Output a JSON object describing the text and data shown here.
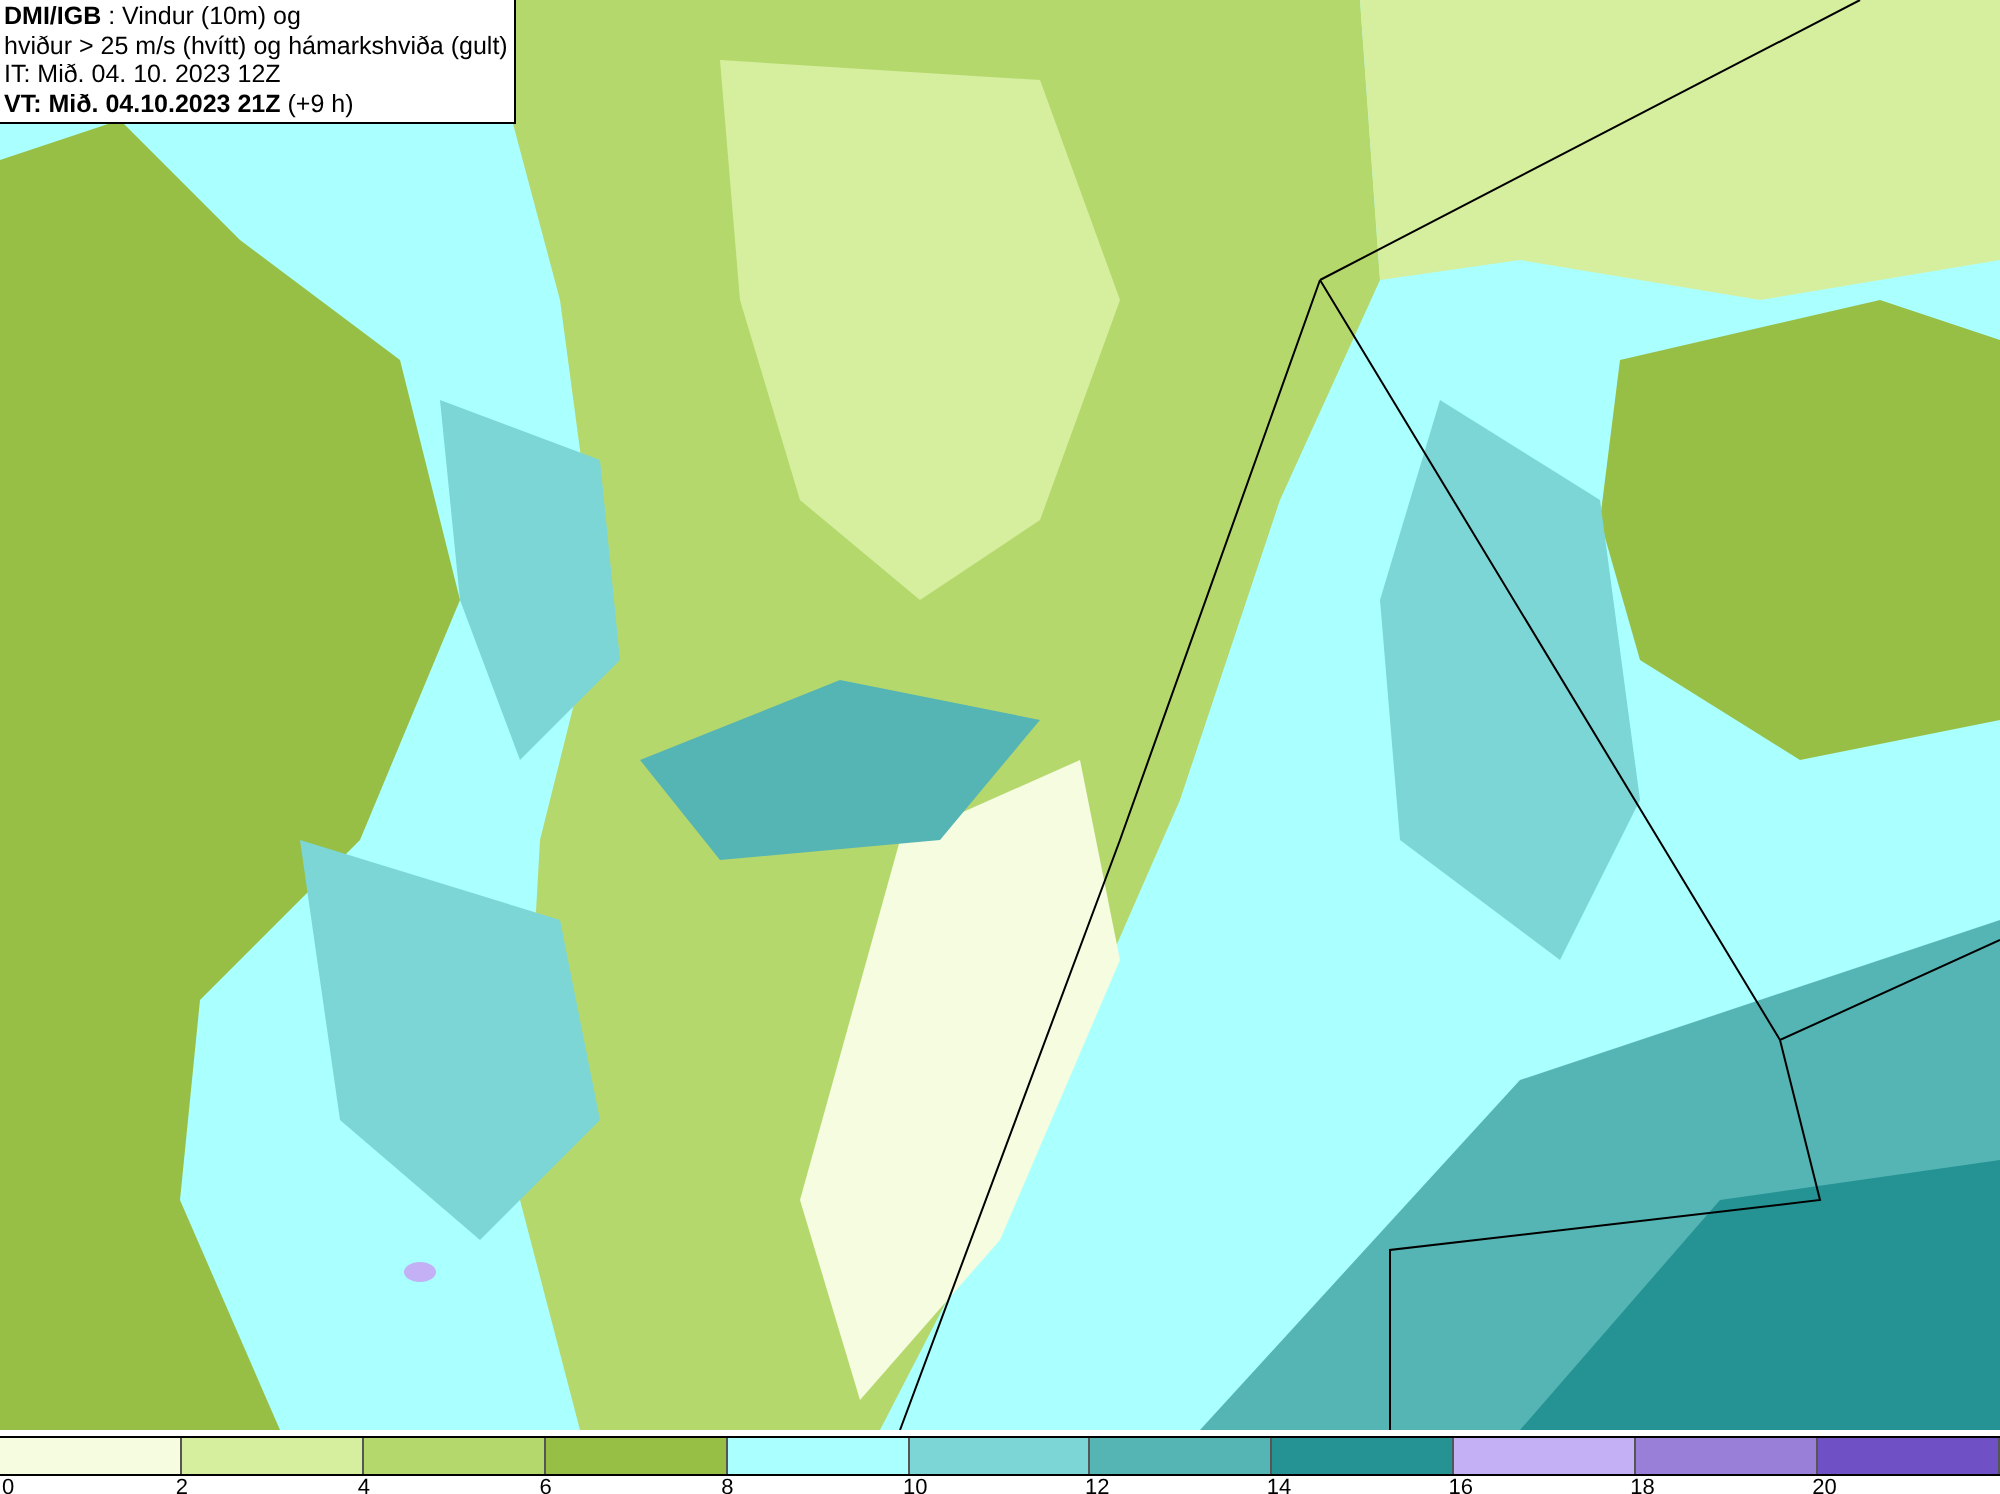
{
  "header": {
    "lines": [
      "**DMI/IGB** : Vindur (10m) og",
      "hviður > 25 m/s (hvítt) og hámarkshviða (gult)",
      "IT: Mið. 04. 10. 2023 12Z",
      "**VT: Mið. 04.10.2023 21Z** (+9 h)"
    ]
  },
  "legend": {
    "segments": [
      {
        "color": "#f5fce0",
        "label": "0"
      },
      {
        "color": "#d6ef9e",
        "label": "2"
      },
      {
        "color": "#b5d86d",
        "label": "4"
      },
      {
        "color": "#98bf45",
        "label": "6"
      },
      {
        "color": "#aaffff",
        "label": "8"
      },
      {
        "color": "#7cd6d6",
        "label": "10"
      },
      {
        "color": "#55b4b4",
        "label": "12"
      },
      {
        "color": "#259393",
        "label": "14"
      },
      {
        "color": "#c3b0f5",
        "label": "16"
      },
      {
        "color": "#9a7fd9",
        "label": "18"
      },
      {
        "color": "#7050c5",
        "label": "20"
      }
    ]
  }
}
